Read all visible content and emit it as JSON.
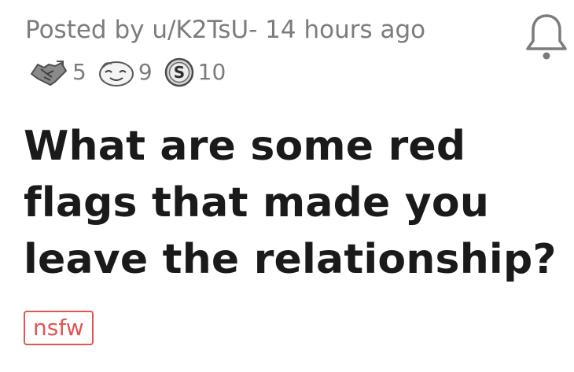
{
  "post": {
    "meta": "Posted by u/K2TsU- 14 hours ago",
    "awards": [
      {
        "icon": "handshake-award-icon",
        "count": "5"
      },
      {
        "icon": "wholesome-award-icon",
        "count": "9"
      },
      {
        "icon": "silver-coin-award-icon",
        "count": "10"
      }
    ],
    "title": "What are some red flags that made you leave the relationship?",
    "flair": "nsfw"
  },
  "icons": {
    "notification": "bell-icon"
  },
  "colors": {
    "meta_text": "#7c7c7c",
    "title_text": "#1a1a1b",
    "flair": "#e05654"
  }
}
